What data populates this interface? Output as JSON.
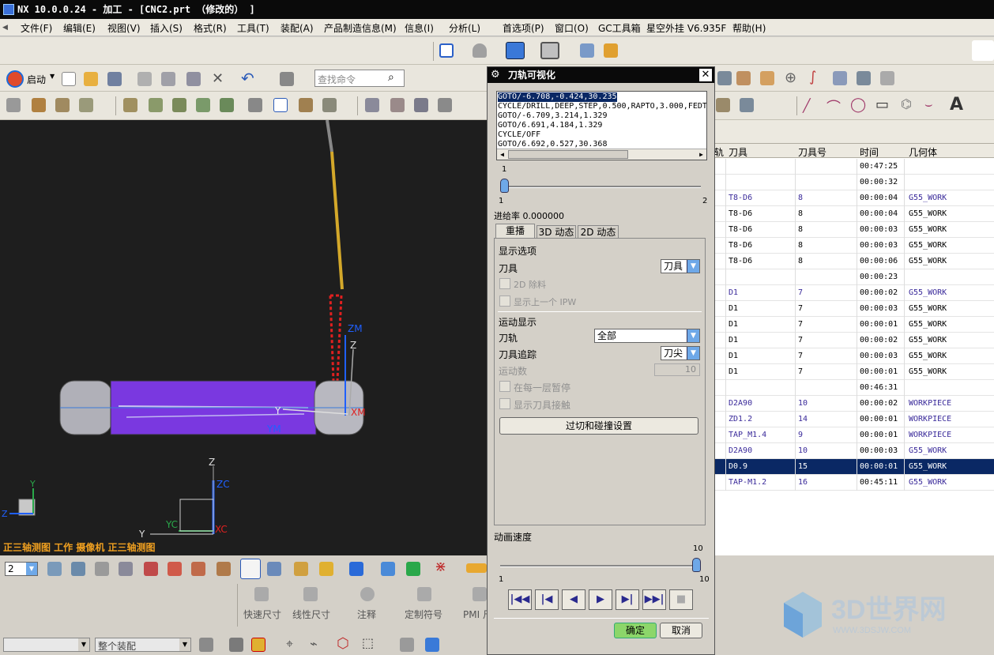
{
  "titlebar": {
    "title": "NX 10.0.0.24 - 加工 - [CNC2.prt （修改的） ]"
  },
  "menu": {
    "items": [
      "文件(F)",
      "编辑(E)",
      "视图(V)",
      "插入(S)",
      "格式(R)",
      "工具(T)",
      "装配(A)",
      "产品制造信息(M)",
      "信息(I)",
      "分析(L)",
      "首选项(P)",
      "窗口(O)",
      "GC工具箱",
      "星空外挂 V6.935F",
      "帮助(H)"
    ]
  },
  "toolbar": {
    "start_label": "启动",
    "search_placeholder": "查找命令"
  },
  "viewport": {
    "status_text": "正三轴测图 工作 摄像机 正三轴测图",
    "axis_labels": {
      "zm": "ZM",
      "z": "Z",
      "y": "Y",
      "xm": "XM",
      "ym": "YM",
      "zc": "ZC",
      "z2": "Z",
      "yc": "YC",
      "y2": "Y",
      "xc": "XC",
      "vy": "Y",
      "vz": "Z"
    },
    "colors": {
      "background": "#1e1e1e",
      "stock": "#7a38e0",
      "tool": "#c8a020",
      "axis_blue": "#2060ff"
    }
  },
  "dialog": {
    "title": "刀轨可视化",
    "goto_lines": [
      "GOTO/-6.708,-0.424,30.235",
      "CYCLE/DRILL,DEEP,STEP,0.500,RAPTO,3.000,FEDTO",
      "GOTO/-6.709,3.214,1.329",
      "GOTO/6.691,4.184,1.329",
      "CYCLE/OFF",
      "GOTO/6.692,0.527,30.368"
    ],
    "slider1": {
      "top_value": "1",
      "min_label": "1",
      "max_label": "2",
      "position": 0.0
    },
    "feed_rate": "进给率 0.000000",
    "tabs": [
      "重播",
      "3D 动态",
      "2D 动态"
    ],
    "display_options_label": "显示选项",
    "tool_label": "刀具",
    "tool_value": "刀具",
    "remove_2d_label": "2D 除料",
    "show_prev_ipw_label": "显示上一个 IPW",
    "motion_display_label": "运动显示",
    "toolpath_label": "刀轨",
    "toolpath_value": "全部",
    "tool_trace_label": "刀具追踪",
    "tool_trace_value": "刀尖",
    "motion_count_label": "运动数",
    "motion_count_value": "10",
    "pause_each_layer_label": "在每一层暂停",
    "show_tool_contact_label": "显示刀具接触",
    "gouge_button": "过切和碰撞设置",
    "animation_speed_label": "动画速度",
    "slider2": {
      "top_value": "10",
      "min_label": "1",
      "max_label": "10",
      "position": 1.0
    },
    "ok_button": "确定",
    "cancel_button": "取消"
  },
  "op_table": {
    "headers": [
      "轨",
      "刀具",
      "刀具号",
      "时间",
      "几何体"
    ],
    "rows": [
      {
        "tool": "",
        "num": "",
        "time": "00:47:25",
        "geom": "",
        "link": false,
        "sel": false
      },
      {
        "tool": "",
        "num": "",
        "time": "00:00:32",
        "geom": "",
        "link": false,
        "sel": false
      },
      {
        "tool": "T8-D6",
        "num": "8",
        "time": "00:00:04",
        "geom": "G55_WORK",
        "link": true,
        "sel": false
      },
      {
        "tool": "T8-D6",
        "num": "8",
        "time": "00:00:04",
        "geom": "G55_WORK",
        "link": false,
        "sel": false
      },
      {
        "tool": "T8-D6",
        "num": "8",
        "time": "00:00:03",
        "geom": "G55_WORK",
        "link": false,
        "sel": false
      },
      {
        "tool": "T8-D6",
        "num": "8",
        "time": "00:00:03",
        "geom": "G55_WORK",
        "link": false,
        "sel": false
      },
      {
        "tool": "T8-D6",
        "num": "8",
        "time": "00:00:06",
        "geom": "G55_WORK",
        "link": false,
        "sel": false
      },
      {
        "tool": "",
        "num": "",
        "time": "00:00:23",
        "geom": "",
        "link": false,
        "sel": false
      },
      {
        "tool": "D1",
        "num": "7",
        "time": "00:00:02",
        "geom": "G55_WORK",
        "link": true,
        "sel": false
      },
      {
        "tool": "D1",
        "num": "7",
        "time": "00:00:03",
        "geom": "G55_WORK",
        "link": false,
        "sel": false
      },
      {
        "tool": "D1",
        "num": "7",
        "time": "00:00:01",
        "geom": "G55_WORK",
        "link": false,
        "sel": false
      },
      {
        "tool": "D1",
        "num": "7",
        "time": "00:00:02",
        "geom": "G55_WORK",
        "link": false,
        "sel": false
      },
      {
        "tool": "D1",
        "num": "7",
        "time": "00:00:03",
        "geom": "G55_WORK",
        "link": false,
        "sel": false
      },
      {
        "tool": "D1",
        "num": "7",
        "time": "00:00:01",
        "geom": "G55_WORK",
        "link": false,
        "sel": false
      },
      {
        "tool": "",
        "num": "",
        "time": "00:46:31",
        "geom": "",
        "link": false,
        "sel": false
      },
      {
        "tool": "D2A90",
        "num": "10",
        "time": "00:00:02",
        "geom": "WORKPIECE",
        "link": true,
        "sel": false
      },
      {
        "tool": "ZD1.2",
        "num": "14",
        "time": "00:00:01",
        "geom": "WORKPIECE",
        "link": true,
        "sel": false
      },
      {
        "tool": "TAP_M1.4",
        "num": "9",
        "time": "00:00:01",
        "geom": "WORKPIECE",
        "link": true,
        "sel": false
      },
      {
        "tool": "D2A90",
        "num": "10",
        "time": "00:00:03",
        "geom": "G55_WORK",
        "link": true,
        "sel": false
      },
      {
        "tool": "D0.9",
        "num": "15",
        "time": "00:00:01",
        "geom": "G55_WORK",
        "link": false,
        "sel": true
      },
      {
        "tool": "TAP-M1.2",
        "num": "16",
        "time": "00:45:11",
        "geom": "G55_WORK",
        "link": true,
        "sel": false
      }
    ]
  },
  "bottom": {
    "layer_value": "2",
    "pmi_labels": [
      "快速尺寸",
      "线性尺寸",
      "注释",
      "定制符号",
      "PMI 尺"
    ],
    "assembly_filter": "整个装配"
  },
  "watermark": {
    "brand": "3D世界网",
    "url": "WWW.3DSJW.COM"
  }
}
